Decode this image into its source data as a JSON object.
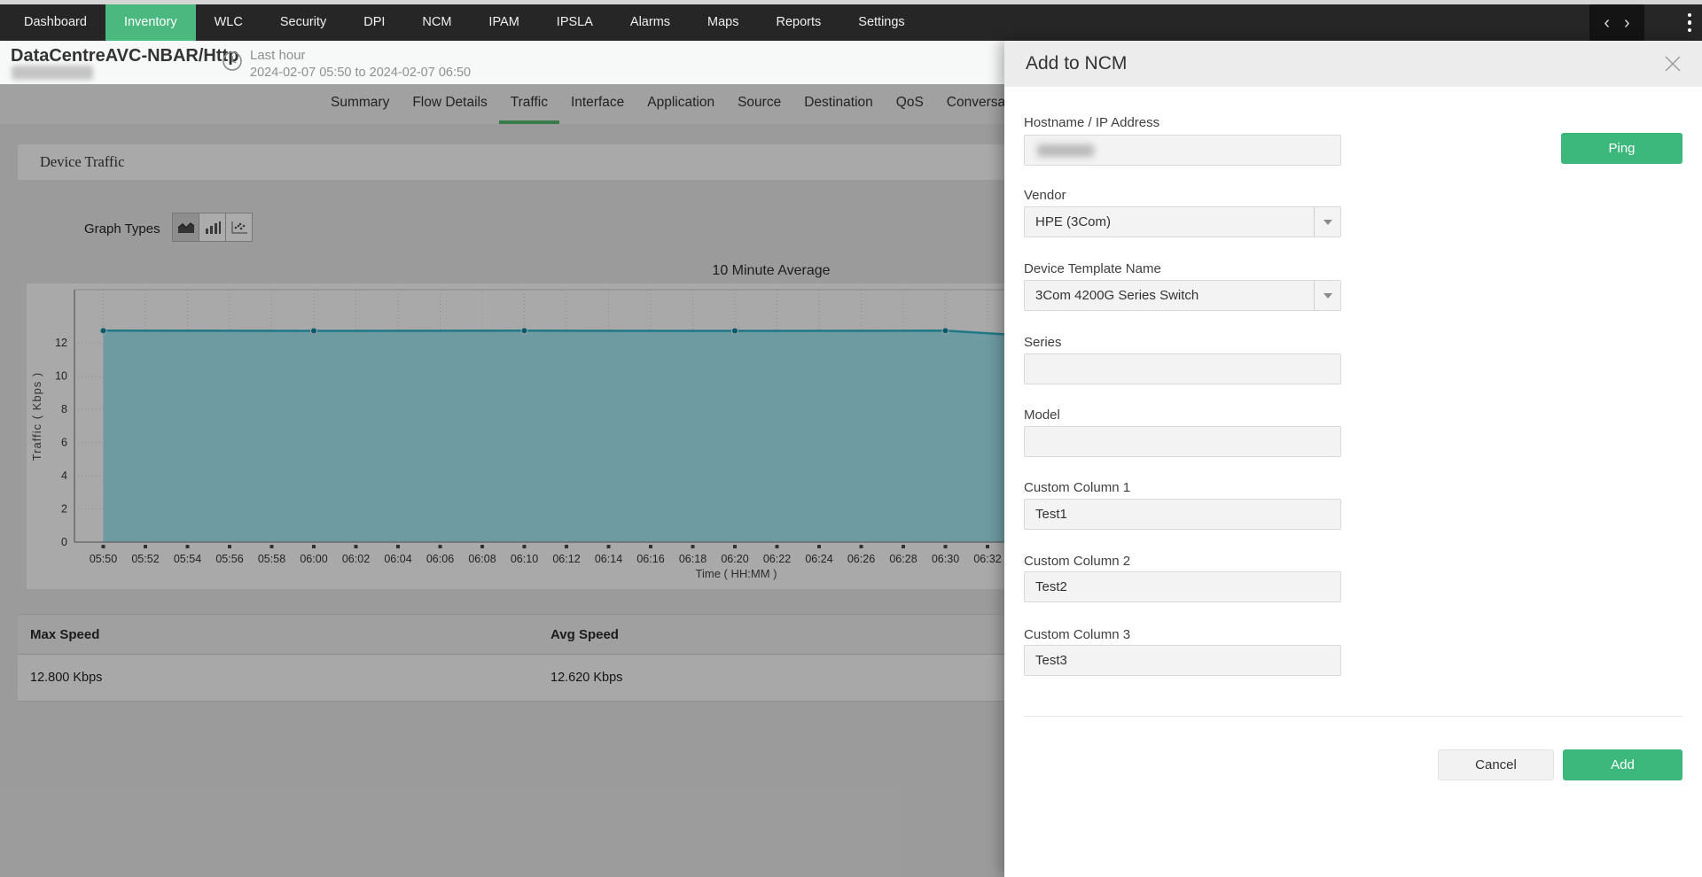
{
  "nav": {
    "items": [
      {
        "label": "Dashboard",
        "active": false
      },
      {
        "label": "Inventory",
        "active": true
      },
      {
        "label": "WLC",
        "active": false
      },
      {
        "label": "Security",
        "active": false
      },
      {
        "label": "DPI",
        "active": false
      },
      {
        "label": "NCM",
        "active": false
      },
      {
        "label": "IPAM",
        "active": false
      },
      {
        "label": "IPSLA",
        "active": false
      },
      {
        "label": "Alarms",
        "active": false
      },
      {
        "label": "Maps",
        "active": false
      },
      {
        "label": "Reports",
        "active": false
      },
      {
        "label": "Settings",
        "active": false
      }
    ],
    "back_arrow": "‹",
    "forward_arrow": "›",
    "overflow_menu_icon": "vertical-dots",
    "active_color": "#4bb87f"
  },
  "header": {
    "title": "DataCentreAVC-NBAR/Http",
    "subtitle_redacted": true,
    "time_icon": "clock",
    "range_label": "Last hour",
    "range_value": "2024-02-07 05:50 to 2024-02-07 06:50"
  },
  "tabs": {
    "items": [
      "Summary",
      "Flow Details",
      "Traffic",
      "Interface",
      "Application",
      "Source",
      "Destination",
      "QoS",
      "Conversation"
    ],
    "active": "Traffic",
    "active_underline_color": "#54b96e"
  },
  "section": {
    "title": "Device Traffic"
  },
  "graph_types": {
    "label": "Graph Types",
    "options": [
      "area-chart",
      "bar-chart",
      "scatter-chart"
    ],
    "selected": "area-chart"
  },
  "chart_data": {
    "type": "area",
    "title": "10 Minute Average",
    "xlabel": "Time ( HH:MM )",
    "ylabel": "Traffic ( Kbps )",
    "x_ticks": [
      "05:50",
      "05:52",
      "05:54",
      "05:56",
      "05:58",
      "06:00",
      "06:02",
      "06:04",
      "06:06",
      "06:08",
      "06:10",
      "06:12",
      "06:14",
      "06:16",
      "06:18",
      "06:20",
      "06:22",
      "06:24",
      "06:26",
      "06:28",
      "06:30",
      "06:32"
    ],
    "y_ticks": [
      0,
      2,
      4,
      6,
      8,
      10,
      12
    ],
    "ylim": [
      0,
      15.2
    ],
    "grid": "dotted",
    "points": [
      {
        "t": "05:50",
        "v": 12.73
      },
      {
        "t": "06:00",
        "v": 12.72
      },
      {
        "t": "06:10",
        "v": 12.73
      },
      {
        "t": "06:20",
        "v": 12.72
      },
      {
        "t": "06:30",
        "v": 12.73
      },
      {
        "t": "06:34",
        "v": 12.42
      }
    ],
    "series_color": "#2fb3c7",
    "fill_color": "#a5e6f2",
    "marker_color": "#0d87a0"
  },
  "table": {
    "headers": [
      "Max Speed",
      "Avg Speed"
    ],
    "rows": [
      [
        "12.800 Kbps",
        "12.620 Kbps"
      ]
    ]
  },
  "modal": {
    "title": "Add to NCM",
    "close_icon": "x",
    "fields": {
      "hostname": {
        "label": "Hostname / IP Address",
        "value": "",
        "redacted": true
      },
      "vendor": {
        "label": "Vendor",
        "value": "HPE (3Com)",
        "type": "select"
      },
      "template": {
        "label": "Device Template Name",
        "value": "3Com 4200G Series Switch",
        "type": "select"
      },
      "series": {
        "label": "Series",
        "value": ""
      },
      "model": {
        "label": "Model",
        "value": ""
      },
      "cc1": {
        "label": "Custom Column 1",
        "value": "Test1"
      },
      "cc2": {
        "label": "Custom Column 2",
        "value": "Test2"
      },
      "cc3": {
        "label": "Custom Column 3",
        "value": "Test3"
      }
    },
    "ping_label": "Ping",
    "cancel_label": "Cancel",
    "add_label": "Add",
    "button_color": "#3cb87c"
  }
}
